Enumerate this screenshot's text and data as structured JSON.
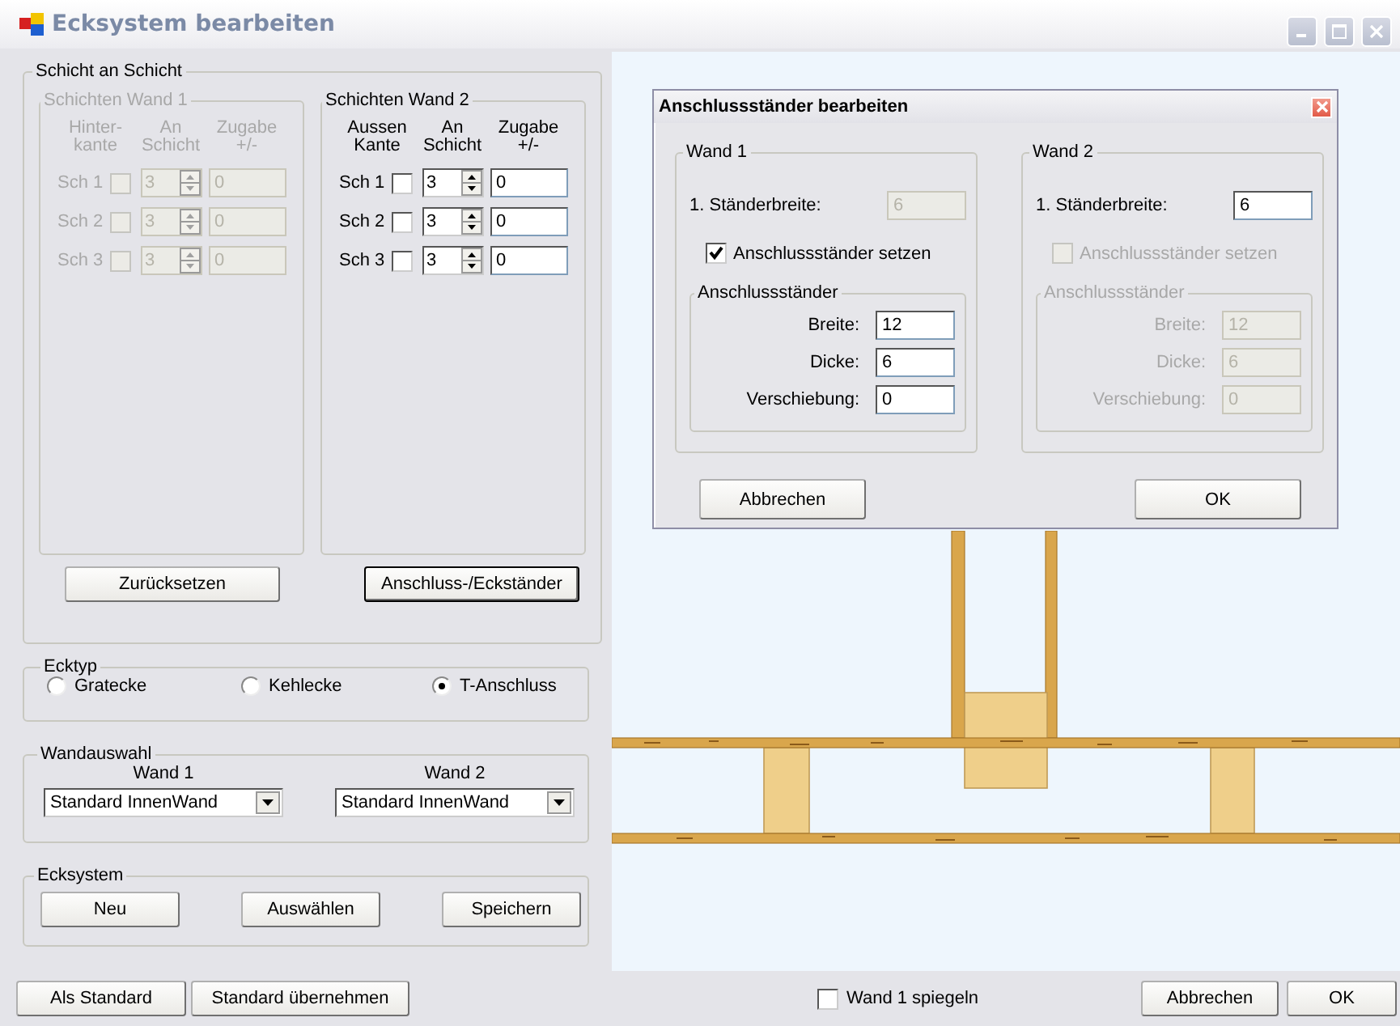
{
  "window": {
    "title": "Ecksystem bearbeiten"
  },
  "layers": {
    "title": "Schicht an Schicht",
    "walls": [
      {
        "title": "Schichten Wand 1",
        "disabled": true,
        "headers": [
          "Hinter-\nkante",
          "An\nSchicht",
          "Zugabe\n+/-"
        ],
        "rows": [
          {
            "label": "Sch 1",
            "checked": false,
            "layer": "3",
            "allowance": "0"
          },
          {
            "label": "Sch 2",
            "checked": false,
            "layer": "3",
            "allowance": "0"
          },
          {
            "label": "Sch 3",
            "checked": false,
            "layer": "3",
            "allowance": "0"
          }
        ]
      },
      {
        "title": "Schichten Wand 2",
        "disabled": false,
        "headers": [
          "Aussen\nKante",
          "An\nSchicht",
          "Zugabe\n+/-"
        ],
        "rows": [
          {
            "label": "Sch 1",
            "checked": false,
            "layer": "3",
            "allowance": "0"
          },
          {
            "label": "Sch 2",
            "checked": false,
            "layer": "3",
            "allowance": "0"
          },
          {
            "label": "Sch 3",
            "checked": false,
            "layer": "3",
            "allowance": "0"
          }
        ]
      }
    ],
    "buttons": [
      {
        "label": "Zurücksetzen",
        "focused": false
      },
      {
        "label": "Anschluss-/Eckständer",
        "focused": true
      }
    ]
  },
  "corner_type": {
    "title": "Ecktyp",
    "options": [
      {
        "label": "Gratecke",
        "selected": false
      },
      {
        "label": "Kehlecke",
        "selected": false
      },
      {
        "label": "T-Anschluss",
        "selected": true
      }
    ]
  },
  "wall_selection": {
    "title": "Wandauswahl",
    "walls": [
      {
        "label": "Wand 1",
        "value": "Standard InnenWand"
      },
      {
        "label": "Wand 2",
        "value": "Standard InnenWand"
      }
    ]
  },
  "corner_system": {
    "title": "Ecksystem",
    "buttons": [
      "Neu",
      "Auswählen",
      "Speichern"
    ]
  },
  "dialog": {
    "title": "Anschlussständer bearbeiten",
    "walls": [
      {
        "title": "Wand 1",
        "stud_width": {
          "label": "1. Ständerbreite:",
          "value": "6",
          "disabled": true
        },
        "set_stud": {
          "label": "Anschlussständer setzen",
          "checked": true,
          "disabled": false
        },
        "stud": {
          "title": "Anschlussständer",
          "disabled": false,
          "fields": [
            {
              "label": "Breite:",
              "value": "12"
            },
            {
              "label": "Dicke:",
              "value": "6"
            },
            {
              "label": "Verschiebung:",
              "value": "0"
            }
          ]
        }
      },
      {
        "title": "Wand 2",
        "stud_width": {
          "label": "1. Ständerbreite:",
          "value": "6",
          "disabled": false
        },
        "set_stud": {
          "label": "Anschlussständer setzen",
          "checked": false,
          "disabled": true
        },
        "stud": {
          "title": "Anschlussständer",
          "disabled": true,
          "fields": [
            {
              "label": "Breite:",
              "value": "12"
            },
            {
              "label": "Dicke:",
              "value": "6"
            },
            {
              "label": "Verschiebung:",
              "value": "0"
            }
          ]
        }
      }
    ],
    "buttons": [
      "Abbrechen",
      "OK"
    ]
  },
  "footer": {
    "buttons_left": [
      "Als Standard",
      "Standard übernehmen"
    ],
    "mirror": {
      "label": "Wand 1 spiegeln",
      "checked": false
    },
    "buttons_right": [
      "Abbrechen",
      "OK"
    ]
  }
}
